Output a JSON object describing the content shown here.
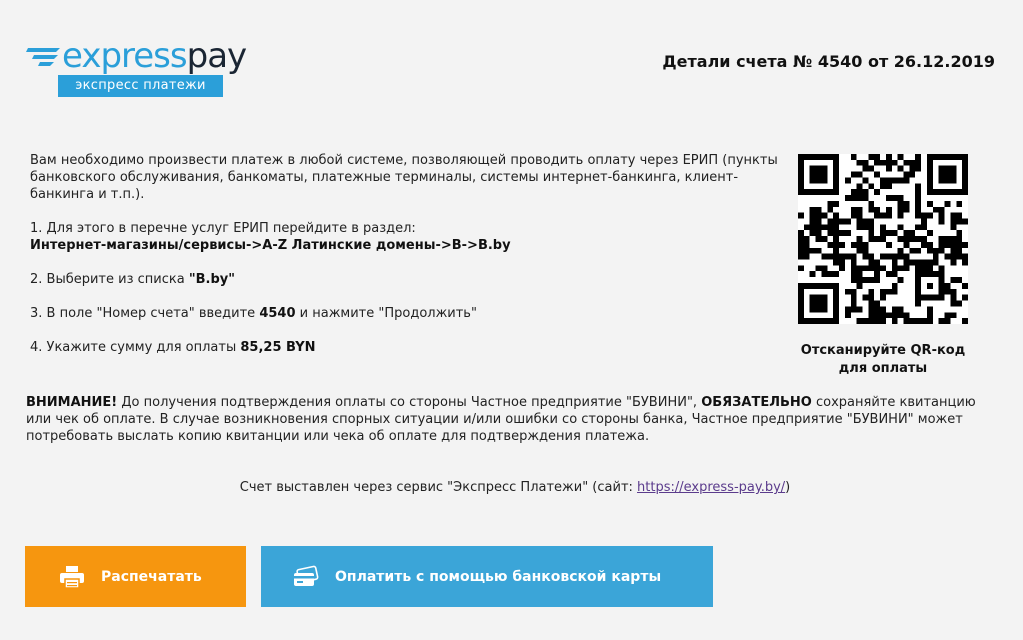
{
  "brand": {
    "name_part1": "express",
    "name_part2": "pay",
    "tagline": "экспресс платежи"
  },
  "invoice": {
    "title": "Детали счета № 4540 от 26.12.2019"
  },
  "instructions": {
    "intro": "Вам необходимо произвести платеж в любой системе, позволяющей проводить оплату через ЕРИП (пункты банковского обслуживания, банкоматы, платежные терминалы, системы интернет-банкинга, клиент-банкинга и т.п.).",
    "step1_text": "1. Для этого в перечне услуг ЕРИП перейдите в раздел:",
    "step1_path": "Интернет-магазины/сервисы->A-Z Латинские домены->B->B.by",
    "step2_text": "2. Выберите из списка ",
    "step2_value": "\"B.by\"",
    "step3_text_a": "3. В поле \"Номер счета\" введите ",
    "step3_value": "4540",
    "step3_text_b": " и нажмите \"Продолжить\"",
    "step4_text": "4. Укажите сумму для оплаты ",
    "step4_value": "85,25 BYN"
  },
  "qr": {
    "caption": "Отсканируйте QR-код для оплаты"
  },
  "warning": {
    "label": "ВНИМАНИЕ!",
    "text_a": " До получения подтверждения оплаты со стороны Частное предприятие \"БУВИНИ\", ",
    "emphasis": "ОБЯЗАТЕЛЬНО",
    "text_b": " сохраняйте квитанцию или чек об оплате. В случае возникновения спорных ситуации и/или ошибки со стороны банка, Частное предприятие \"БУВИНИ\" может потребовать выслать копию квитанции или чека об оплате для подтверждения платежа."
  },
  "service_note": {
    "text": "Счет выставлен через сервис \"Экспресс Платежи\" (сайт: ",
    "link": "https://express-pay.by/",
    "text_end": ")"
  },
  "buttons": {
    "print_label": "Распечатать",
    "pay_card_label": "Оплатить с помощью банковской карты"
  },
  "colors": {
    "brand_blue": "#2b9fd9",
    "print_orange": "#f6960f",
    "pay_blue": "#3ba5d8",
    "link_purple": "#5b3b8c"
  }
}
